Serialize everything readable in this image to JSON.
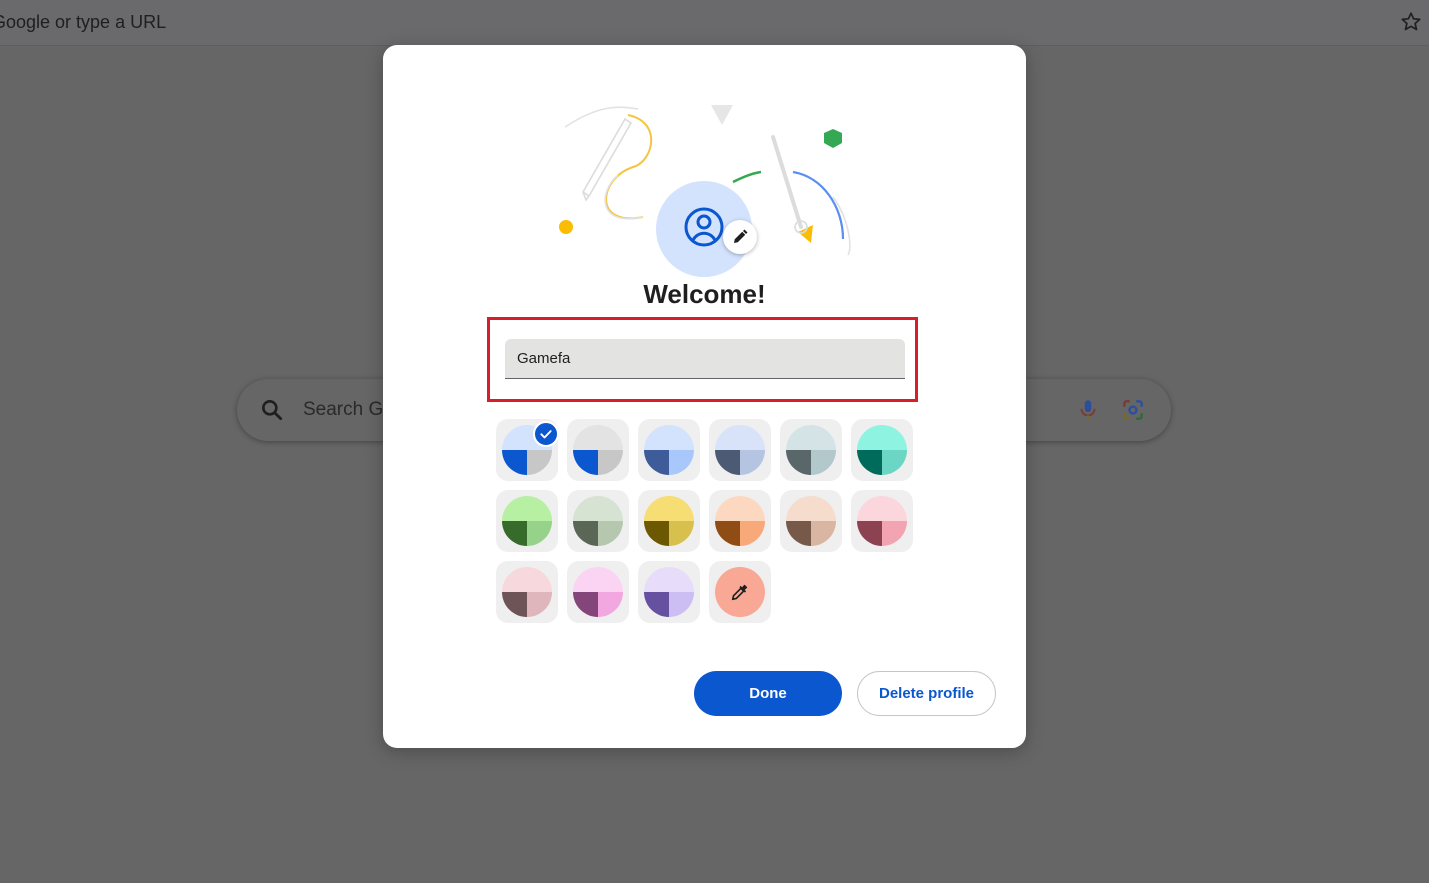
{
  "browser": {
    "omnibox_text": "Google or type a URL",
    "star_icon": "star-outline-icon"
  },
  "ntp": {
    "search_placeholder": "Search G",
    "icons": [
      "search-icon",
      "microphone-icon",
      "google-lens-icon"
    ]
  },
  "dialog": {
    "title": "Welcome!",
    "avatar_icon": "account-circle-icon",
    "avatar_edit_icon": "pencil-icon",
    "name_field_value": "Gamefa",
    "done_label": "Done",
    "delete_label": "Delete profile",
    "colors": {
      "accent": "#0b57d0",
      "highlight_border": "#d81e2b"
    },
    "themes": [
      {
        "top": "#d3e3fd",
        "bl": "#0b57d0",
        "br": "#c7c7c7",
        "selected": true
      },
      {
        "top": "#e3e3e3",
        "bl": "#0b57d0",
        "br": "#c7c7c7",
        "selected": false
      },
      {
        "top": "#d3e3fd",
        "bl": "#3e5c99",
        "br": "#a8c7fa",
        "selected": false
      },
      {
        "top": "#d8e2f8",
        "bl": "#4d5a73",
        "br": "#b5c4e1",
        "selected": false
      },
      {
        "top": "#d4e4e6",
        "bl": "#59666a",
        "br": "#b2c8cb",
        "selected": false
      },
      {
        "top": "#8ef3e0",
        "bl": "#006b5a",
        "br": "#6ad6c3",
        "selected": false
      },
      {
        "top": "#b7f0a2",
        "bl": "#366b2b",
        "br": "#96d28a",
        "selected": false
      },
      {
        "top": "#d7e3d2",
        "bl": "#5a6656",
        "br": "#b6c7b0",
        "selected": false
      },
      {
        "top": "#f6dd74",
        "bl": "#6b5800",
        "br": "#d8c04f",
        "selected": false
      },
      {
        "top": "#fcd8c0",
        "bl": "#8f4c14",
        "br": "#f7a97a",
        "selected": false
      },
      {
        "top": "#f5dccd",
        "bl": "#77594a",
        "br": "#d9b6a2",
        "selected": false
      },
      {
        "top": "#fcd6dd",
        "bl": "#8d4252",
        "br": "#f2a4b3",
        "selected": false
      },
      {
        "top": "#f7d9dd",
        "bl": "#6f5457",
        "br": "#deb6bb",
        "selected": false
      },
      {
        "top": "#fbd4f3",
        "bl": "#84457a",
        "br": "#f2a7e1",
        "selected": false
      },
      {
        "top": "#e7dcfa",
        "bl": "#6650a0",
        "br": "#ccbdf3",
        "selected": false
      }
    ],
    "custom_color_icon": "eyedropper-icon"
  }
}
